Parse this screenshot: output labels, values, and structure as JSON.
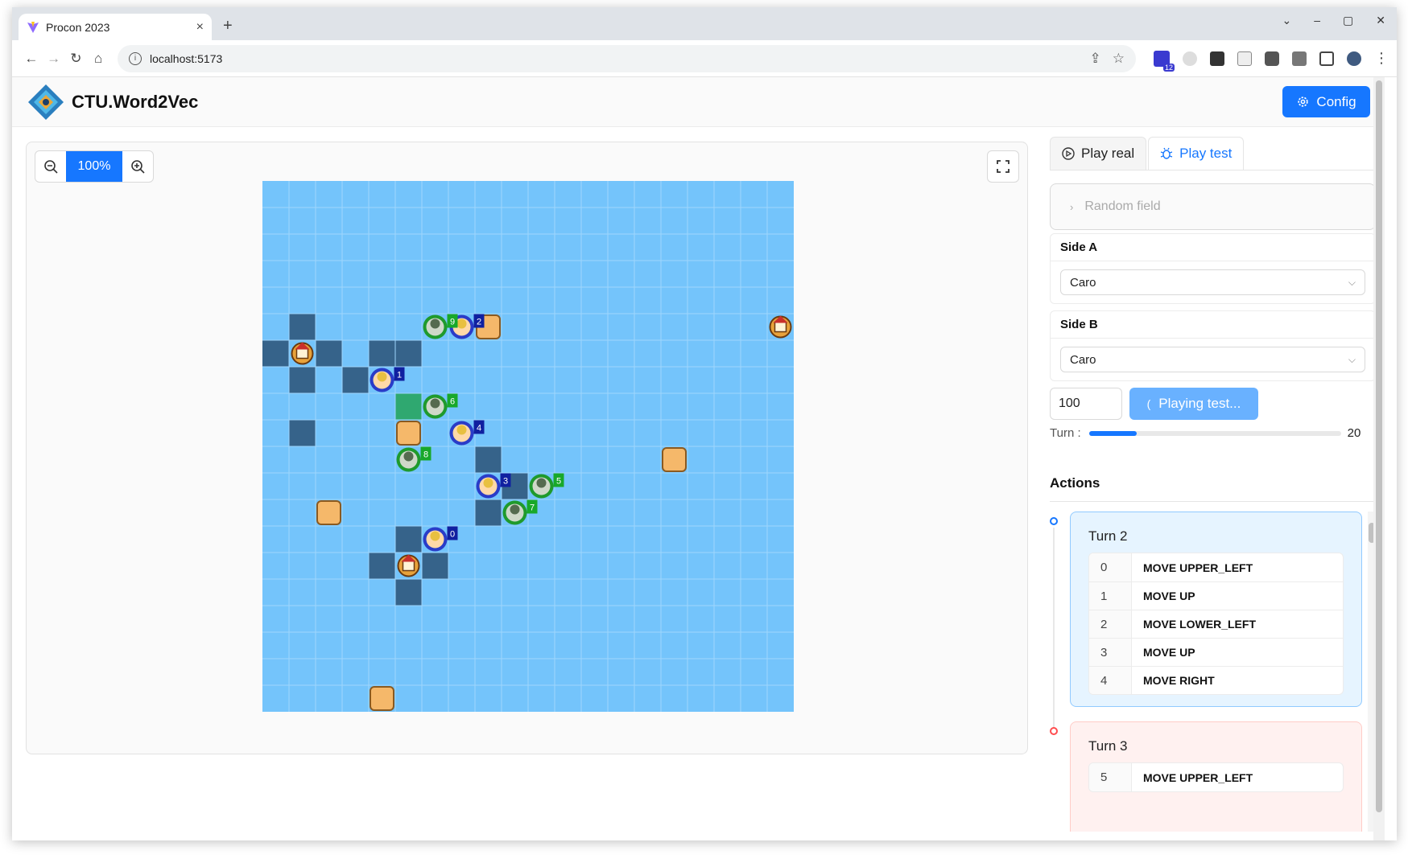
{
  "browser": {
    "tab_title": "Procon 2023",
    "tab_close": "×",
    "new_tab": "+",
    "url": "localhost:5173",
    "extension_badge": "12",
    "window_controls": [
      "⌄",
      "–",
      "▢",
      "✕"
    ]
  },
  "app": {
    "brand": "CTU.Word2Vec",
    "config_label": "Config",
    "accent": "#1677ff"
  },
  "board": {
    "zoom_label": "100%",
    "size": 20,
    "tile_color": "#74c4fb",
    "wall_color": "#36638a",
    "territory_color": "#2fa870",
    "walls": [
      [
        1,
        5
      ],
      [
        0,
        6
      ],
      [
        2,
        6
      ],
      [
        1,
        7
      ],
      [
        8,
        10
      ],
      [
        9,
        11
      ],
      [
        8,
        12
      ],
      [
        5,
        13
      ],
      [
        4,
        14
      ],
      [
        6,
        14
      ],
      [
        5,
        15
      ],
      [
        4,
        6
      ],
      [
        5,
        6
      ],
      [
        3,
        7
      ],
      [
        1,
        9
      ]
    ],
    "walls_note": "",
    "territory": [
      [
        5,
        8
      ]
    ],
    "ponds": [
      [
        8,
        5
      ],
      [
        5,
        9
      ],
      [
        15,
        10
      ],
      [
        2,
        12
      ],
      [
        4,
        19
      ]
    ],
    "castles": [
      [
        1,
        6
      ],
      [
        19,
        5
      ],
      [
        5,
        14
      ]
    ],
    "agents_a": [
      {
        "id": "0",
        "col": 6,
        "row": 13
      },
      {
        "id": "1",
        "col": 4,
        "row": 7
      },
      {
        "id": "2",
        "col": 7,
        "row": 5
      },
      {
        "id": "3",
        "col": 8,
        "row": 11
      },
      {
        "id": "4",
        "col": 7,
        "row": 9
      }
    ],
    "agents_b": [
      {
        "id": "5",
        "col": 10,
        "row": 11
      },
      {
        "id": "6",
        "col": 6,
        "row": 8
      },
      {
        "id": "7",
        "col": 9,
        "row": 12
      },
      {
        "id": "8",
        "col": 5,
        "row": 10
      },
      {
        "id": "9",
        "col": 6,
        "row": 5
      }
    ]
  },
  "panel": {
    "tab_real": "Play real",
    "tab_test": "Play test",
    "random_field": "Random field",
    "side_a_label": "Side A",
    "side_a_value": "Caro",
    "side_b_label": "Side B",
    "side_b_value": "Caro",
    "turns_input": "100",
    "play_label": "Playing test...",
    "turn_label": "Turn :",
    "turn_value": "20",
    "turn_progress": 0.19,
    "actions_title": "Actions",
    "turns": [
      {
        "title": "Turn 2",
        "color": "blue",
        "actions": [
          {
            "idx": "0",
            "move": "MOVE UPPER_LEFT"
          },
          {
            "idx": "1",
            "move": "MOVE UP"
          },
          {
            "idx": "2",
            "move": "MOVE LOWER_LEFT"
          },
          {
            "idx": "3",
            "move": "MOVE UP"
          },
          {
            "idx": "4",
            "move": "MOVE RIGHT"
          }
        ]
      },
      {
        "title": "Turn 3",
        "color": "red",
        "actions": [
          {
            "idx": "5",
            "move": "MOVE UPPER_LEFT"
          }
        ]
      }
    ]
  }
}
